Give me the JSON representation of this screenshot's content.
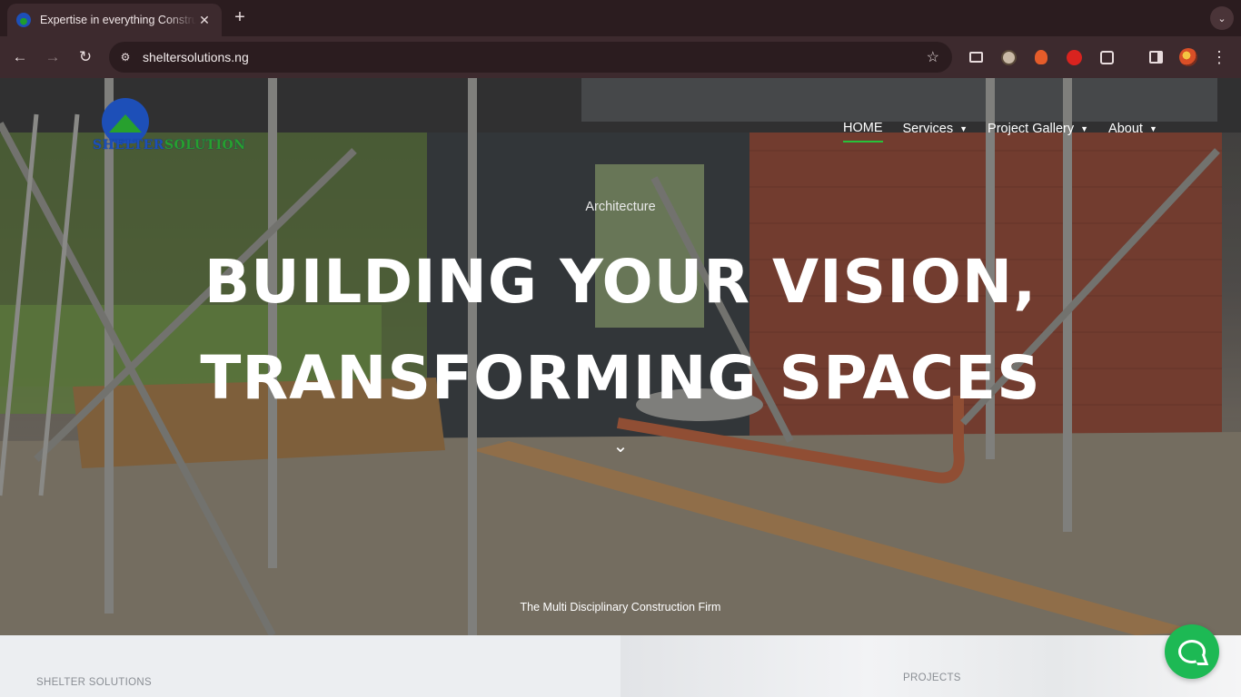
{
  "browser": {
    "tab_title": "Expertise in everything Construction",
    "tab_close": "✕",
    "new_tab": "+",
    "url": "sheltersolutions.ng",
    "icons": [
      "back-arrow-icon",
      "forward-arrow-icon",
      "reload-icon",
      "site-info-icon",
      "star-icon",
      "extensions-icon",
      "profile-icon",
      "menu-icon"
    ]
  },
  "site": {
    "logo": {
      "text_blue": "SHELTER",
      "text_green": "SOLUTION"
    },
    "nav": [
      {
        "label": "HOME",
        "active": true,
        "dropdown": false
      },
      {
        "label": "Services",
        "active": false,
        "dropdown": true
      },
      {
        "label": "Project Gallery",
        "active": false,
        "dropdown": true
      },
      {
        "label": "About",
        "active": false,
        "dropdown": true
      }
    ],
    "hero": {
      "eyebrow": "Architecture",
      "headline_line1": "BUILDING YOUR VISION,",
      "headline_line2": "TRANSFORMING SPACES",
      "tagline": "The Multi Disciplinary Construction Firm"
    },
    "sections": {
      "left_label": "SHELTER SOLUTIONS",
      "right_label": "PROJECTS"
    },
    "colors": {
      "accent_green": "#27c23a",
      "logo_blue": "#1d4fb8",
      "chat_green": "#1db954"
    }
  }
}
